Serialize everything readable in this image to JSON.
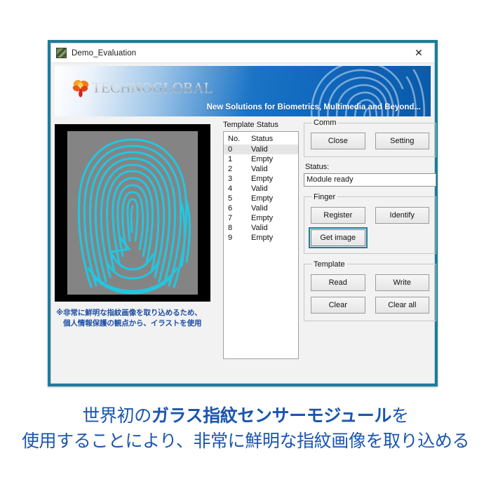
{
  "window": {
    "title": "Demo_Evaluation",
    "icon": "app-icon",
    "close_label": "✕"
  },
  "banner": {
    "logo_text": "TECHNOGLOBAL",
    "tagline": "New Solutions for Biometrics, Multimedia and Beyond...",
    "gradient_from": "#ffffff",
    "gradient_to": "#0a5aa8"
  },
  "preview": {
    "note_line1": "※非常に鮮明な指紋画像を取り込めるため、",
    "note_line2": "個人情報保護の観点から、イラストを使用",
    "ridge_color": "#23c6e0",
    "background_color": "#848484",
    "frame_color": "#000000"
  },
  "template_status": {
    "label": "Template Status",
    "columns": [
      "No.",
      "Status"
    ],
    "rows": [
      {
        "no": "0",
        "status": "Valid",
        "selected": true
      },
      {
        "no": "1",
        "status": "Empty",
        "selected": false
      },
      {
        "no": "2",
        "status": "Valid",
        "selected": false
      },
      {
        "no": "3",
        "status": "Empty",
        "selected": false
      },
      {
        "no": "4",
        "status": "Valid",
        "selected": false
      },
      {
        "no": "5",
        "status": "Empty",
        "selected": false
      },
      {
        "no": "6",
        "status": "Valid",
        "selected": false
      },
      {
        "no": "7",
        "status": "Empty",
        "selected": false
      },
      {
        "no": "8",
        "status": "Valid",
        "selected": false
      },
      {
        "no": "9",
        "status": "Empty",
        "selected": false
      }
    ]
  },
  "comm": {
    "legend": "Comm",
    "close_button": "Close",
    "setting_button": "Setting"
  },
  "status": {
    "label": "Status:",
    "value": "Module ready"
  },
  "finger": {
    "legend": "Finger",
    "register_button": "Register",
    "identify_button": "Identify",
    "get_image_button": "Get image",
    "focused_button": "Get image",
    "focus_color": "#1a7d9c"
  },
  "template": {
    "legend": "Template",
    "read_button": "Read",
    "write_button": "Write",
    "clear_button": "Clear",
    "clear_all_button": "Clear all"
  },
  "caption": {
    "line1_pre": "世界初の",
    "line1_strong": "ガラス指紋センサーモジュール",
    "line1_post": "を",
    "line2": "使用することにより、非常に鮮明な指紋画像を取り込める",
    "color": "#1b56ad"
  }
}
